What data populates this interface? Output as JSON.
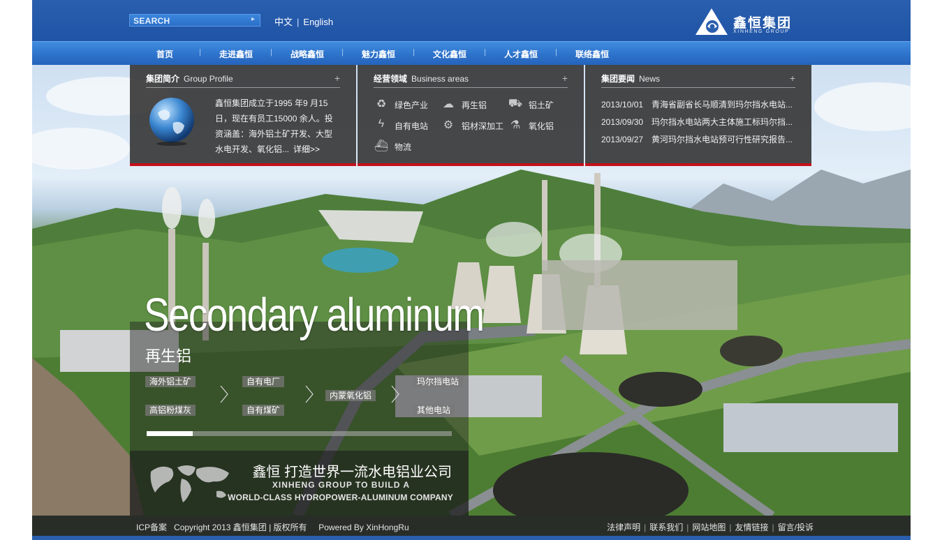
{
  "header": {
    "search_label": "SEARCH",
    "lang_cn": "中文",
    "lang_sep": "|",
    "lang_en": "English",
    "logo_cn": "鑫恒集团",
    "logo_en": "XINHENG GROUP",
    "brand_color": "#2a5fae"
  },
  "nav": {
    "items": [
      "首页",
      "走进鑫恒",
      "战略鑫恒",
      "魅力鑫恒",
      "文化鑫恒",
      "人才鑫恒",
      "联络鑫恒"
    ],
    "separator": "|"
  },
  "panels": {
    "profile": {
      "title_cn": "集团简介",
      "title_en": "Group Profile",
      "plus": "+",
      "text": "鑫恒集团成立于1995 年9 月15日，现在有员工15000 余人。投资涵盖：海外铝土矿开发、大型水电开发、氧化铝...",
      "more": "详细>>",
      "icon": "globe-icon"
    },
    "business": {
      "title_cn": "经营领域",
      "title_en": "Business areas",
      "plus": "+",
      "items": [
        {
          "label": "绿色产业",
          "icon": "recycle-icon"
        },
        {
          "label": "再生铝",
          "icon": "cloud-icon"
        },
        {
          "label": "铝土矿",
          "icon": "cart-icon"
        },
        {
          "label": "自有电站",
          "icon": "lightning-icon"
        },
        {
          "label": "铝材深加工",
          "icon": "gears-icon"
        },
        {
          "label": "氧化铝",
          "icon": "flask-icon"
        },
        {
          "label": "物流",
          "icon": "ship-icon"
        }
      ]
    },
    "news": {
      "title_cn": "集团要闻",
      "title_en": "News",
      "plus": "+",
      "items": [
        {
          "date": "2013/10/01",
          "title": "青海省副省长马顺清到玛尔挡水电站..."
        },
        {
          "date": "2013/09/30",
          "title": "玛尔挡水电站两大主体施工标玛尔挡..."
        },
        {
          "date": "2013/09/27",
          "title": "黄河玛尔挡水电站预可行性研究报告..."
        }
      ]
    },
    "accent_color": "#c4101b"
  },
  "hero": {
    "title_en": "Secondary aluminum",
    "title_cn": "再生铝",
    "tags": [
      "海外铝土矿",
      "自有电厂",
      "内蒙氧化铝",
      "玛尔挡电站",
      "高铝粉煤灰",
      "自有煤矿",
      "其他电站"
    ],
    "progress": 0.15,
    "slogan_cn": "鑫恒 打造世界一流水电铝业公司",
    "slogan_en_1": "XINHENG GROUP TO BUILD A",
    "slogan_en_2": "WORLD-CLASS HYDROPOWER-ALUMINUM COMPANY"
  },
  "footer": {
    "icp": "ICP备案",
    "copyright": "Copyright 2013 鑫恒集团 | 版权所有",
    "powered": "Powered By XinHongRu",
    "links": [
      "法律声明",
      "联系我们",
      "网站地图",
      "友情链接",
      "留言/投诉"
    ],
    "separator": "|"
  }
}
